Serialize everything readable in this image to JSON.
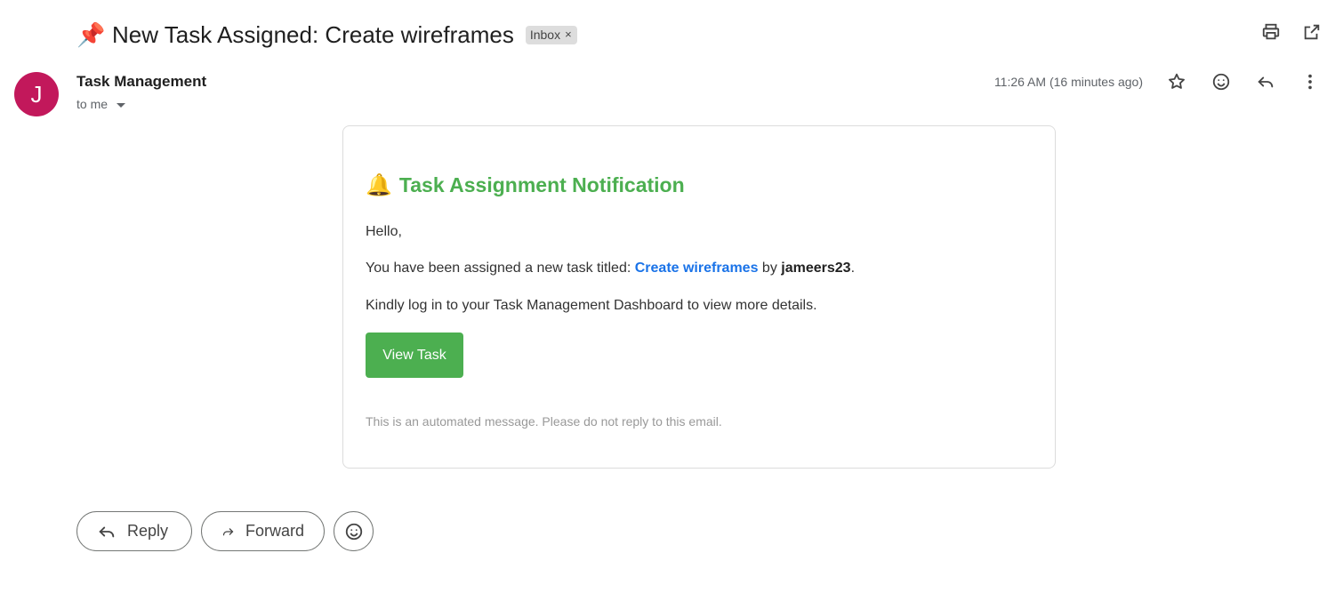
{
  "email": {
    "subject_emoji": "📌",
    "subject": "New Task Assigned: Create wireframes",
    "label": "Inbox",
    "label_remove": "×",
    "sender_initial": "J",
    "sender_name": "Task Management",
    "recipient": "to me",
    "timestamp": "11:26 AM (16 minutes ago)"
  },
  "top_icons": [
    "print-icon",
    "open-in-new-window-icon"
  ],
  "meta_icons": [
    "star-icon",
    "emoji-reaction-icon",
    "reply-icon",
    "more-vert-icon"
  ],
  "body": {
    "title_emoji": "🔔",
    "title": "Task Assignment Notification",
    "greeting": "Hello,",
    "line_prefix": "You have been assigned a new task titled: ",
    "task_name": "Create wireframes",
    "line_middle": " by ",
    "assigner": "jameers23",
    "line_suffix": ".",
    "instruction": "Kindly log in to your Task Management Dashboard to view more details.",
    "button_label": "View Task",
    "footer": "This is an automated message. Please do not reply to this email."
  },
  "actions": {
    "reply_label": "Reply",
    "forward_label": "Forward"
  },
  "colors": {
    "avatar": "#c2185b",
    "title_green": "#4caf50",
    "link_blue": "#1a73e8",
    "button_green": "#4caf50"
  }
}
